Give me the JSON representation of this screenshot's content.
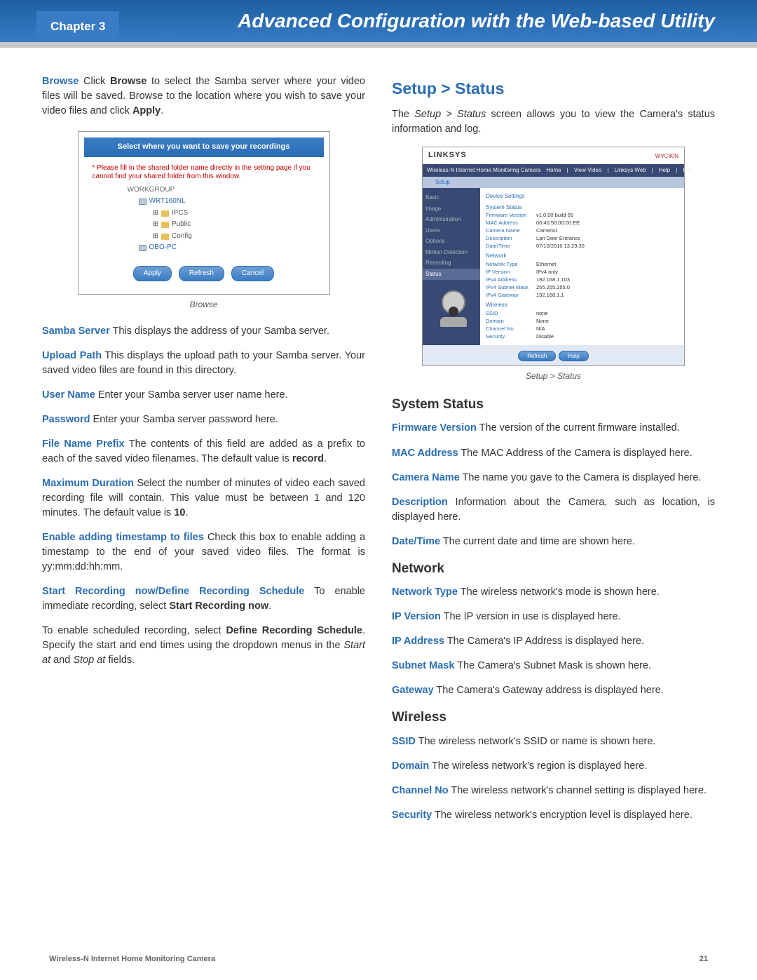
{
  "header": {
    "chapter": "Chapter 3",
    "title": "Advanced Configuration with the Web-based Utility"
  },
  "left": {
    "browse": {
      "term": "Browse",
      "text_a": " Click ",
      "bold1": "Browse",
      "text_b": " to select the Samba server where your video files will be saved. Browse to the location where you wish to save your video files and click ",
      "bold2": "Apply",
      "text_c": "."
    },
    "browse_fig": {
      "titlebar": "Select where you want to save your recordings",
      "warning": "* Please fill in the shared folder name directly in the setting page if you cannot find your shared folder from this window.",
      "group": "WORKGROUP",
      "items": [
        "WRT160NL",
        "IPCS",
        "Public",
        "Config",
        "OBO-PC"
      ],
      "btn_apply": "Apply",
      "btn_refresh": "Refresh",
      "btn_cancel": "Cancel",
      "caption": "Browse"
    },
    "samba_server": {
      "term": "Samba Server",
      "text": " This displays the address of your Samba server."
    },
    "upload_path": {
      "term": "Upload Path",
      "text": " This displays the upload path to your Samba server. Your saved video files are found in this directory."
    },
    "user_name": {
      "term": "User Name",
      "text": " Enter your Samba server user name here."
    },
    "password": {
      "term": "Password",
      "text": " Enter your Samba server password here."
    },
    "prefix": {
      "term": "File Name Prefix",
      "text_a": " The contents of this field are added as a prefix to each of the saved video filenames. The default value is ",
      "bold": "record",
      "text_b": "."
    },
    "maxdur": {
      "term": "Maximum Duration",
      "text_a": " Select the number of minutes of video each saved recording file will contain. This value must be between 1 and 120 minutes. The default value is ",
      "bold": "10",
      "text_b": "."
    },
    "timestamp": {
      "term": "Enable adding timestamp to files",
      "text": " Check this box to enable adding a timestamp to the end of your saved video files. The format is yy:mm:dd:hh:mm."
    },
    "startrec": {
      "term": "Start Recording now/Define Recording Schedule",
      "text_a": " To enable immediate recording, select ",
      "bold": "Start Recording now",
      "text_b": "."
    },
    "sched": {
      "text_a": "To enable scheduled recording, select ",
      "bold": "Define Recording Schedule",
      "text_b": ". Specify the start and end times using the dropdown menus in the ",
      "ital1": "Start at",
      "text_c": " and ",
      "ital2": "Stop at",
      "text_d": " fields."
    }
  },
  "right": {
    "title": "Setup > Status",
    "intro_a": "The ",
    "intro_ital": "Setup > Status",
    "intro_b": " screen allows you to view the Camera's status information and log.",
    "status_fig": {
      "logo": "LINKSYS",
      "model": "WVC80N",
      "subbar_left": "Wireless-N Internet Home Monitoring Camera",
      "nav": [
        "Home",
        "View Video",
        "Linksys Web",
        "Help",
        "Exit"
      ],
      "tab": "Setup",
      "side": [
        "Basic",
        "Image",
        "Administration",
        "Users",
        "Options",
        "Motion Detection",
        "Recording",
        "Status"
      ],
      "details_head": "Device Settings",
      "sec1": "System Status",
      "kv1": [
        [
          "Firmware Version",
          "v1.0.00 build 05"
        ],
        [
          "MAC Address",
          "00:40:50:00:00:EE"
        ],
        [
          "Camera Name",
          "Camera1"
        ],
        [
          "Description",
          "Lan Door Entrance"
        ],
        [
          "Date/Time",
          "07/10/2010   13:29:30"
        ]
      ],
      "sec2": "Network",
      "kv2": [
        [
          "Network Type",
          "Ethernet"
        ],
        [
          "IP Version",
          "IPv4 only"
        ],
        [
          "IPv4 Address",
          "192.168.1.103"
        ],
        [
          "IPv4 Subnet Mask",
          "255.255.255.0"
        ],
        [
          "IPv4 Gateway",
          "192.168.1.1"
        ]
      ],
      "sec3": "Wireless",
      "kv3": [
        [
          "SSID",
          "none"
        ],
        [
          "Domain",
          "None"
        ],
        [
          "Channel No",
          "N/A"
        ],
        [
          "Security",
          "Disable"
        ]
      ],
      "btn_refresh": "Refresh",
      "btn_help": "Help",
      "caption": "Setup > Status"
    },
    "system_status": {
      "heading": "System Status",
      "fw": {
        "term": "Firmware Version",
        "text": " The version of the current firmware installed."
      },
      "mac": {
        "term": "MAC Address",
        "text": " The MAC Address of the Camera is displayed here."
      },
      "cam": {
        "term": "Camera Name",
        "text": " The name you gave to the Camera is displayed here."
      },
      "desc": {
        "term": "Description",
        "text": " Information about the Camera, such as location, is displayed here."
      },
      "dt": {
        "term": "Date/Time",
        "text": " The current date and time are shown here."
      }
    },
    "network": {
      "heading": "Network",
      "nt": {
        "term": "Network Type",
        "text": " The wireless network's mode is shown here."
      },
      "ipv": {
        "term": "IP Version",
        "text": " The IP version in use is displayed here."
      },
      "ipa": {
        "term": "IP Address",
        "text": " The Camera's IP Address is displayed here."
      },
      "sm": {
        "term": "Subnet Mask",
        "text": " The Camera's Subnet Mask is shown here."
      },
      "gw": {
        "term": "Gateway",
        "text": " The Camera's Gateway address is displayed here."
      }
    },
    "wireless": {
      "heading": "Wireless",
      "ssid": {
        "term": "SSID",
        "text": " The wireless network's SSID or name is shown here."
      },
      "dom": {
        "term": "Domain",
        "text": " The wireless network's region is displayed here."
      },
      "ch": {
        "term": "Channel No",
        "text": " The wireless network's channel setting is displayed here."
      },
      "sec": {
        "term": "Security",
        "text": " The wireless network's encryption level is displayed here."
      }
    }
  },
  "footer": {
    "product": "Wireless-N Internet Home Monitoring Camera",
    "page": "21"
  }
}
